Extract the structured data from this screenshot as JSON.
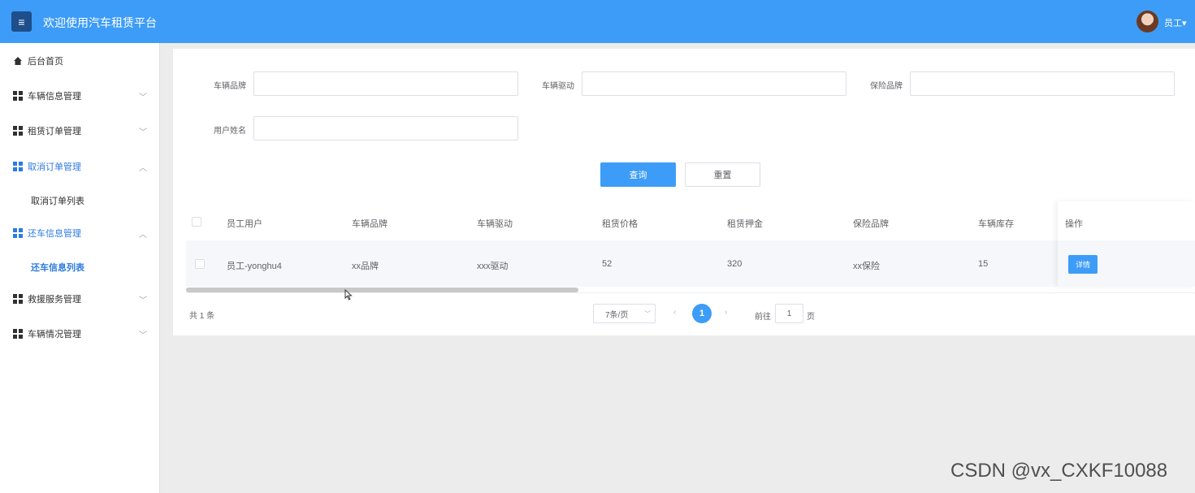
{
  "header": {
    "menu_icon": "hamburger-icon",
    "title": "欢迎使用汽车租赁平台",
    "user_label": "员工",
    "user_caret": "▾",
    "bg_color": "#3d9cf7"
  },
  "sidebar": {
    "home": "后台首页",
    "items": [
      {
        "label": "车辆信息管理",
        "chevron": "﹀"
      },
      {
        "label": "租赁订单管理",
        "chevron": "﹀"
      },
      {
        "label": "取消订单管理",
        "chevron": "︿"
      },
      {
        "label": "还车信息管理",
        "chevron": "︿"
      },
      {
        "label": "救援服务管理",
        "chevron": "﹀"
      },
      {
        "label": "车辆情况管理",
        "chevron": "﹀"
      }
    ],
    "sub_items": [
      "取消订单列表",
      "还车信息列表"
    ]
  },
  "search_form": {
    "labels": [
      "车辆品牌",
      "车辆驱动",
      "保险品牌",
      "用户姓名"
    ],
    "values": [
      "",
      "",
      "",
      ""
    ],
    "query_button": "查询",
    "reset_button": "重置"
  },
  "table": {
    "columns": [
      "员工用户",
      "车辆品牌",
      "车辆驱动",
      "租赁价格",
      "租赁押金",
      "保险品牌",
      "车辆库存",
      "操作"
    ],
    "rows": [
      {
        "cells": [
          "员工-yonghu4",
          "xx品牌",
          "xxx驱动",
          "52",
          "320",
          "xx保险",
          "15"
        ],
        "action": "详情"
      }
    ]
  },
  "pagination": {
    "total": "共 1 条",
    "page_size": "7条/页",
    "prev": "‹",
    "current_page": "1",
    "next": "›",
    "goto_label": "前往",
    "goto_value": "1",
    "goto_suffix": "页"
  },
  "watermark": "CSDN @vx_CXKF10088"
}
